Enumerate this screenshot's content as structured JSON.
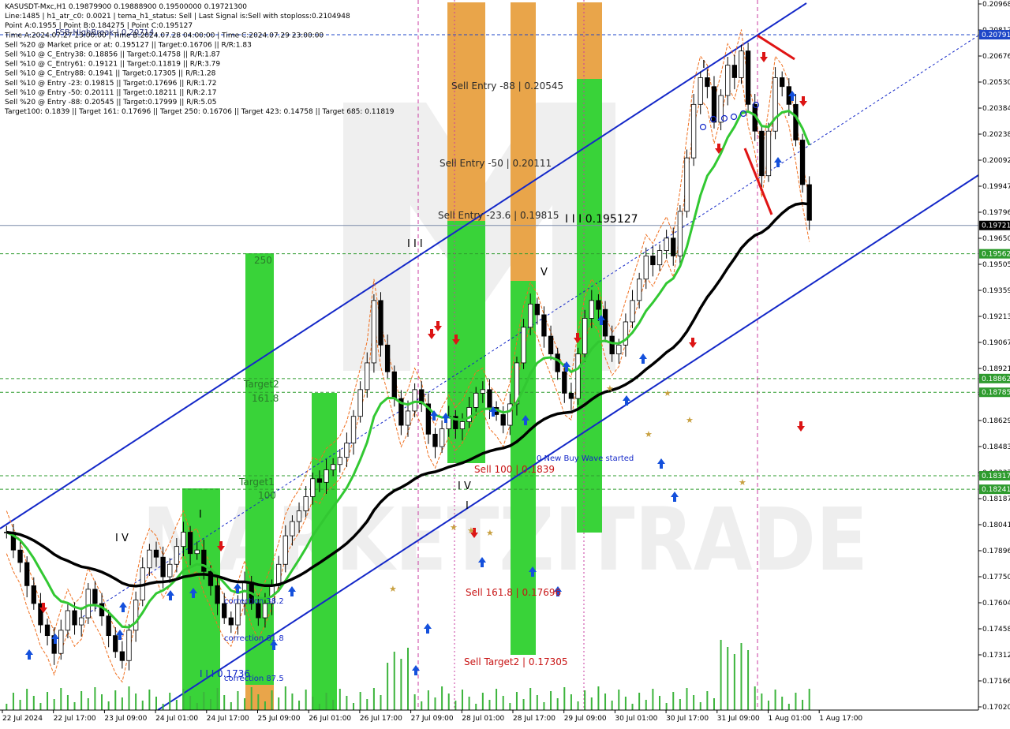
{
  "info_lines": [
    "KASUSDT-Mxc,H1  0.19879900 0.19888900 0.19500000 0.19721300",
    "Line:1485  |  h1_atr_c0: 0.0021  |  tema_h1_status: Sell  |  Last Signal is:Sell with stoploss:0.2104948",
    "Point A:0.1955 | Point B:0.184275 | Point C:0.195127",
    "Time A:2024.07.27 13:00:00 | Time B:2024.07.28 04:00:00 | Time C:2024.07.29 23:00:00",
    "Sell %20 @ Market price or at: 0.195127 || Target:0.16706 || R/R:1.83",
    "Sell %10 @ C_Entry38: 0.18856 || Target:0.14758 || R/R:1.87",
    "Sell %10 @ C_Entry61: 0.19121 || Target:0.11819 || R/R:3.79",
    "Sell %10 @ C_Entry88: 0.1941 || Target:0.17305 || R/R:1.28",
    "Sell %10 @ Entry -23: 0.19815 || Target:0.17696 || R/R:1.72",
    "Sell %10 @ Entry -50: 0.20111 || Target:0.18211 || R/R:2.17",
    "Sell %20 @ Entry -88: 0.20545 || Target:0.17999 || R/R:5.05",
    "Target100: 0.1839 || Target 161: 0.17696 || Target 250: 0.16706 || Target 423: 0.14758 || Target 685: 0.11819"
  ],
  "annotations": {
    "fsb_high": "FSB-HighBreak | 0.20714",
    "sell_entry_88": "Sell Entry -88 | 0.20545",
    "sell_entry_50": "Sell Entry -50 | 0.20111",
    "sell_entry_23": "Sell Entry -23.6 | 0.19815",
    "point_c": "I I I 0.195127",
    "sell_100": "Sell 100 | 0.1839",
    "sell_161": "Sell 161.8 | 0.17696",
    "sell_target2": "Sell Target2 | 0.17305",
    "new_buy_wave": "0 New Buy Wave started",
    "target2": "Target2",
    "target2_val": "161.8",
    "target1": "Target1",
    "target1_val": "100",
    "t250": "250",
    "corr_382": "correction 38.2",
    "corr_618": "correction 61.8",
    "corr_875": "correction 87.5",
    "pt_1736": "I I I 0.1736",
    "wave_iii": "I I I",
    "wave_iv_left": "I V",
    "wave_iv_mid": "I V",
    "wave_v": "V",
    "wave_i_left": "I",
    "wave_i_mid": "I",
    "wave_i_right": "I",
    "watermark": "MARKETZITRADE"
  },
  "chart_data": {
    "type": "candlestick",
    "symbol": "KASUSDT-Mxc",
    "timeframe": "H1",
    "ylim": [
      0.1702,
      0.20968
    ],
    "y_ticks": [
      "0.20968",
      "0.20817",
      "0.20676",
      "0.20530",
      "0.20384",
      "0.20238",
      "0.20092",
      "0.19947",
      "0.19796",
      "0.19650",
      "0.19505",
      "0.19359",
      "0.19213",
      "0.19067",
      "0.18921",
      "0.18775",
      "0.18629",
      "0.18483",
      "0.18337",
      "0.18187",
      "0.18041",
      "0.17896",
      "0.17750",
      "0.17604",
      "0.17458",
      "0.17312",
      "0.17166",
      "0.17020"
    ],
    "x_ticks": [
      "22 Jul 2024",
      "22 Jul 17:00",
      "23 Jul 09:00",
      "24 Jul 01:00",
      "24 Jul 17:00",
      "25 Jul 09:00",
      "26 Jul 01:00",
      "26 Jul 17:00",
      "27 Jul 09:00",
      "28 Jul 01:00",
      "28 Jul 17:00",
      "29 Jul 09:00",
      "30 Jul 01:00",
      "30 Jul 17:00",
      "31 Jul 09:00",
      "1 Aug 01:00",
      "1 Aug 17:00"
    ],
    "close_path": [
      [
        0.18,
        0.179,
        0.1783,
        0.177,
        0.176,
        0.1748,
        0.1742,
        0.1732,
        0.1745,
        0.1756,
        0.1748,
        0.1752,
        0.1768,
        0.176,
        0.1753,
        0.1742,
        0.1733,
        0.1728,
        0.1745,
        0.1762,
        0.178,
        0.179,
        0.1786,
        0.1775,
        0.1782,
        0.1792,
        0.18,
        0.1788,
        0.179,
        0.1778,
        0.177,
        0.176,
        0.1752,
        0.1748,
        0.176,
        0.1772,
        0.176,
        0.1752,
        0.176,
        0.177,
        0.1782,
        0.1798,
        0.1806,
        0.1812,
        0.182,
        0.183,
        0.1828,
        0.1835,
        0.1838,
        0.1842,
        0.185,
        0.1865,
        0.188,
        0.1895,
        0.193,
        0.1905,
        0.189,
        0.1875,
        0.186,
        0.1868,
        0.188,
        0.1872,
        0.1855,
        0.1848,
        0.1858,
        0.1865,
        0.1858,
        0.1862,
        0.187,
        0.1878,
        0.188,
        0.187,
        0.1866,
        0.186,
        0.1872,
        0.1895,
        0.1915,
        0.1928,
        0.1922,
        0.191,
        0.19,
        0.189,
        0.1878,
        0.1875,
        0.19,
        0.192,
        0.193,
        0.1925,
        0.191,
        0.19,
        0.1905,
        0.1918,
        0.193,
        0.1942,
        0.1955,
        0.195,
        0.1958,
        0.1965,
        0.1955,
        0.198,
        0.201,
        0.204,
        0.2055,
        0.205,
        0.203,
        0.2045,
        0.2062,
        0.2055,
        0.207,
        0.204,
        0.2025,
        0.2,
        0.2025,
        0.2055,
        0.205,
        0.204,
        0.202,
        0.1995,
        0.1975
      ]
    ],
    "price_tags": [
      {
        "label": "0.20791",
        "color": "#1e46c8",
        "price": 0.20791
      },
      {
        "label": "0.19721",
        "color": "#000000",
        "price": 0.19721
      },
      {
        "label": "0.19562",
        "color": "#2e9b2e",
        "price": 0.19562
      },
      {
        "label": "0.18862",
        "color": "#2e9b2e",
        "price": 0.18862
      },
      {
        "label": "0.18785",
        "color": "#2e9b2e",
        "price": 0.18785
      },
      {
        "label": "0.18317",
        "color": "#2e9b2e",
        "price": 0.18317
      },
      {
        "label": "0.18241",
        "color": "#2e9b2e",
        "price": 0.18241
      }
    ],
    "horizontal_levels": [
      {
        "price": 0.20791,
        "color": "#1e46c8",
        "style": "dashed"
      },
      {
        "price": 0.19721,
        "color": "#7a8aa8",
        "style": "solid"
      },
      {
        "price": 0.19562,
        "color": "#2e9b2e",
        "style": "dashed"
      },
      {
        "price": 0.18862,
        "color": "#2e9b2e",
        "style": "dashed"
      },
      {
        "price": 0.18785,
        "color": "#2e9b2e",
        "style": "dashed"
      },
      {
        "price": 0.18317,
        "color": "#2e9b2e",
        "style": "dashed"
      },
      {
        "price": 0.18241,
        "color": "#2e9b2e",
        "style": "dashed"
      }
    ],
    "colors": {
      "bull_bar": "#2ed12e",
      "bear_bar": "#e8a040",
      "channel": "#1428c8",
      "ema_green": "#32c832",
      "ema_black": "#000000",
      "sell_text": "#c81414",
      "buy_arrow": "#1450dc",
      "sell_arrow": "#dc1414"
    }
  }
}
